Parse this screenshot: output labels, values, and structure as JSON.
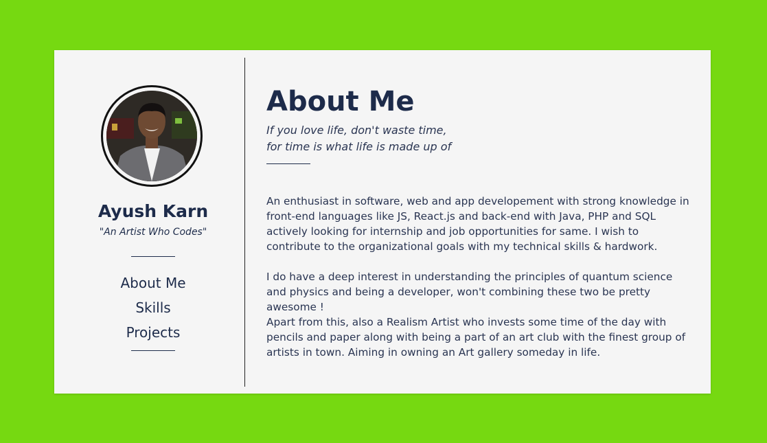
{
  "colors": {
    "background": "#76d911",
    "card": "#f5f5f5",
    "text": "#1d2b4a"
  },
  "profile": {
    "avatar_icon": "profile-photo",
    "name": "Ayush Karn",
    "tagline": "\"An Artist Who Codes\""
  },
  "nav": {
    "items": [
      {
        "label": "About Me"
      },
      {
        "label": "Skills"
      },
      {
        "label": "Projects"
      }
    ]
  },
  "about": {
    "title": "About Me",
    "quote_line1": "If you love life, don't waste time,",
    "quote_line2": "for time is what life is made up of",
    "paragraphs": [
      "An enthusiast in software, web and app developement with strong knowledge in front-end languages like JS, React.js and back-end with Java, PHP and SQL actively looking for internship and job opportunities for same. I wish to contribute to the organizational goals with my technical skills & hardwork.",
      "I do have a deep interest in understanding the principles of quantum science and physics and being a developer, won't combining these two be pretty awesome !",
      "Apart from this, also a Realism Artist who invests some time of the day with pencils and paper along with being a part of an art club with the finest group of artists in town. Aiming in owning an Art gallery someday in life."
    ]
  }
}
